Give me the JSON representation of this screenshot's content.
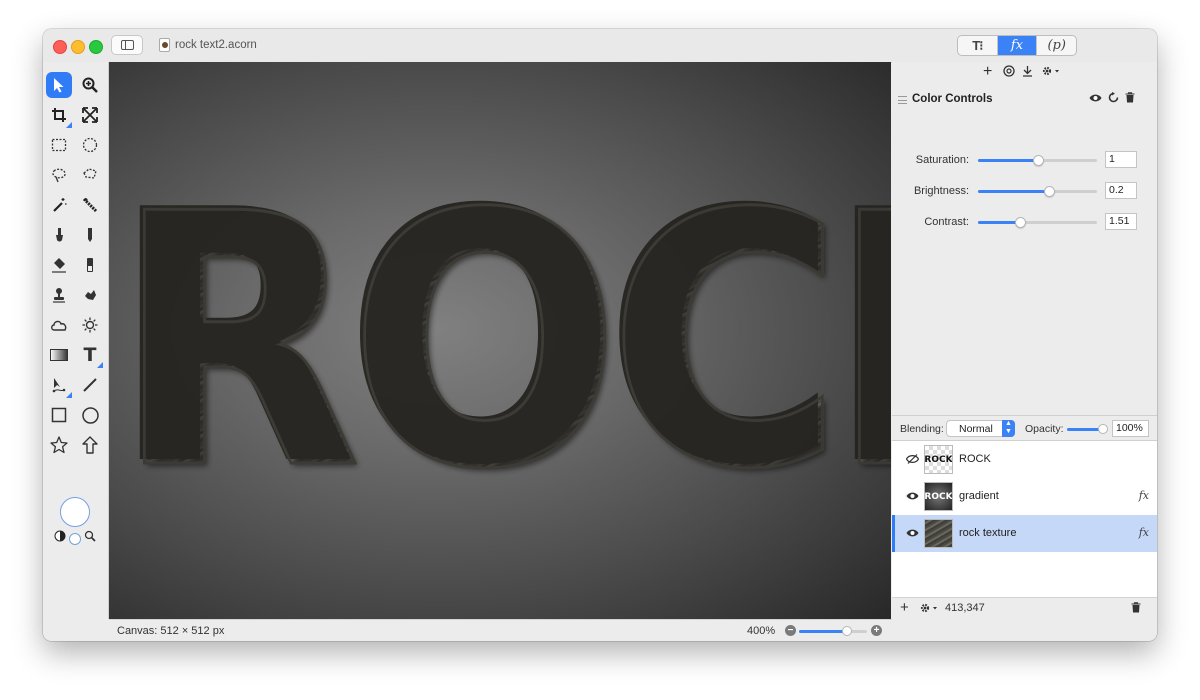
{
  "window": {
    "document_title": "rock text2.acorn"
  },
  "header": {
    "segments": [
      {
        "label": "T⁝",
        "name": "tools"
      },
      {
        "label": "fx",
        "name": "effects"
      },
      {
        "label": "(p)",
        "name": "properties"
      }
    ],
    "selected_segment": "fx"
  },
  "toolbox": {
    "tools": [
      {
        "name": "select-arrow",
        "icon": "arrow-icon"
      },
      {
        "name": "zoom",
        "icon": "magnifier-plus-icon"
      },
      {
        "name": "crop",
        "icon": "crop-icon"
      },
      {
        "name": "transform",
        "icon": "resize-arrows-icon"
      },
      {
        "name": "rect-select",
        "icon": "marquee-rect-icon"
      },
      {
        "name": "oval-select",
        "icon": "marquee-oval-icon"
      },
      {
        "name": "lasso",
        "icon": "lasso-icon"
      },
      {
        "name": "polygon-lasso",
        "icon": "polygon-lasso-icon"
      },
      {
        "name": "magic-wand",
        "icon": "magic-wand-icon"
      },
      {
        "name": "instant-alpha",
        "icon": "instant-alpha-icon"
      },
      {
        "name": "brush",
        "icon": "brush-icon"
      },
      {
        "name": "pencil",
        "icon": "pencil-icon"
      },
      {
        "name": "paint-bucket",
        "icon": "paint-bucket-icon"
      },
      {
        "name": "eraser",
        "icon": "eraser-icon"
      },
      {
        "name": "clone-stamp",
        "icon": "stamp-icon"
      },
      {
        "name": "smudge",
        "icon": "smudge-icon"
      },
      {
        "name": "cloud",
        "icon": "cloud-icon"
      },
      {
        "name": "dodge-burn",
        "icon": "sun-icon"
      },
      {
        "name": "gradient",
        "icon": "gradient-icon"
      },
      {
        "name": "text",
        "icon": "text-icon"
      },
      {
        "name": "bezier-pen",
        "icon": "pen-icon"
      },
      {
        "name": "line",
        "icon": "line-icon"
      },
      {
        "name": "rectangle",
        "icon": "rectangle-icon"
      },
      {
        "name": "oval",
        "icon": "oval-icon"
      },
      {
        "name": "star",
        "icon": "star-icon"
      },
      {
        "name": "arrow-shape",
        "icon": "up-arrow-icon"
      }
    ],
    "foreground_color": "#ffffff"
  },
  "canvas": {
    "artwork_text": "ROCK",
    "info": "Canvas: 512 × 512 px",
    "zoom": "400%",
    "zoom_level": 0.7
  },
  "filters": {
    "name": "Color Controls",
    "controls": [
      {
        "label": "Saturation:",
        "value": "1",
        "fraction": 0.5
      },
      {
        "label": "Brightness:",
        "value": "0.2",
        "fraction": 0.6
      },
      {
        "label": "Contrast:",
        "value": "1.51",
        "fraction": 0.35
      }
    ]
  },
  "blending": {
    "label": "Blending:",
    "mode": "Normal",
    "opacity_label": "Opacity:",
    "opacity": "100%"
  },
  "layers": [
    {
      "name": "ROCK",
      "thumb_text": "ROCK",
      "visible": false,
      "fx": "",
      "selected": false
    },
    {
      "name": "gradient",
      "thumb_text": "ROCK",
      "visible": true,
      "fx": "fx",
      "selected": false
    },
    {
      "name": "rock texture",
      "thumb_text": "",
      "visible": true,
      "fx": "fx",
      "selected": true
    }
  ],
  "panel_status": {
    "coordinates": "413,347"
  },
  "colors": {
    "accent": "#2f7cf6",
    "selection": "#c6d8f7"
  }
}
